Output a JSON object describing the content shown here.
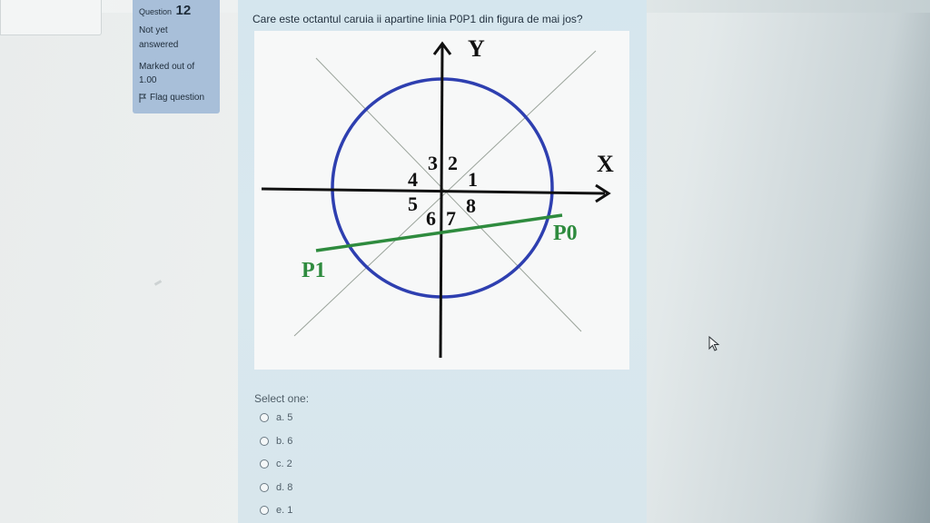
{
  "question_info": {
    "question_prefix": "Question",
    "question_number": "12",
    "state_line1": "Not yet",
    "state_line2": "answered",
    "marked_line1": "Marked out of",
    "marked_line2": "1.00",
    "flag_label": "Flag question",
    "flag_icon": "flag-icon"
  },
  "question": {
    "text": "Care este octantul caruia ii apartine linia P0P1 din figura de mai jos?"
  },
  "figure": {
    "axis_y_label": "Y",
    "axis_x_label": "X",
    "octant_labels": [
      "1",
      "2",
      "3",
      "4",
      "5",
      "6",
      "7",
      "8"
    ],
    "point_p0_label": "P0",
    "point_p1_label": "P1",
    "colors": {
      "axes": "#111111",
      "circle": "#2e3fb0",
      "diagonals": "#9aa39a",
      "line": "#2e8b3e",
      "point_labels": "#2e8b3e"
    }
  },
  "answers": {
    "prompt": "Select one:",
    "options": [
      "a. 5",
      "b. 6",
      "c. 2",
      "d. 8",
      "e. 1"
    ]
  }
}
